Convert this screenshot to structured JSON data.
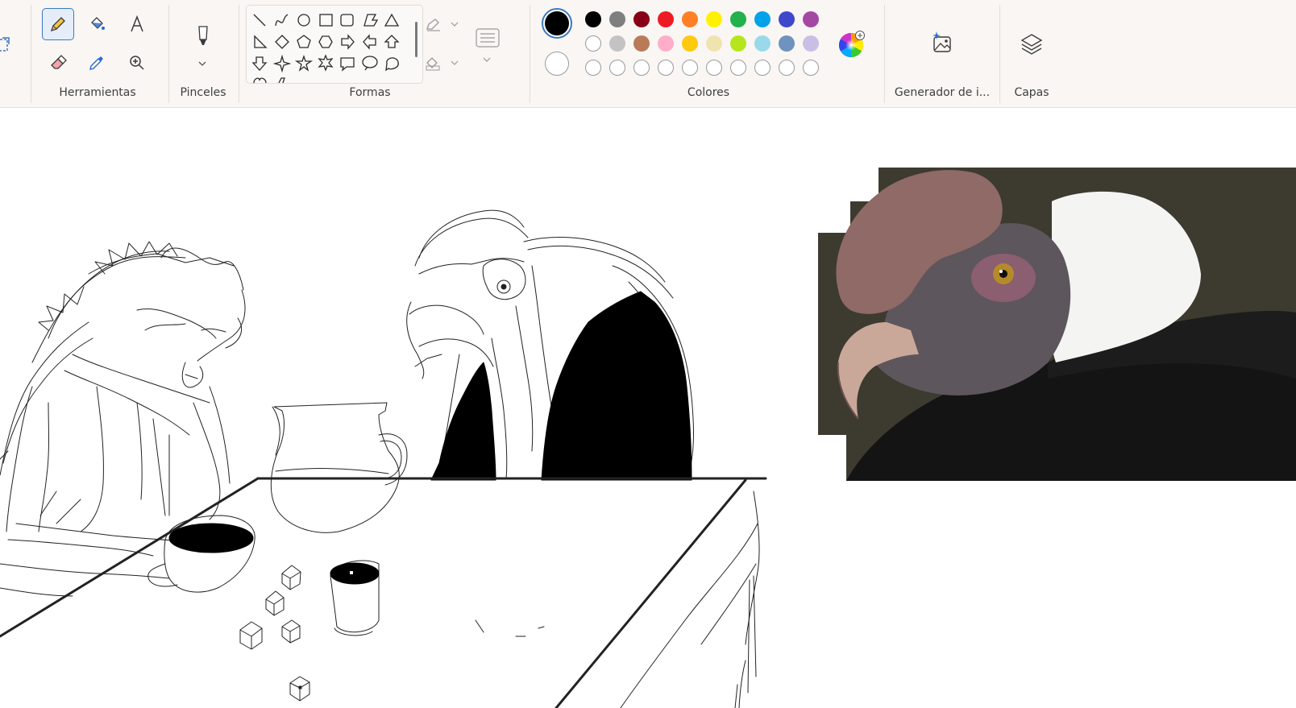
{
  "ribbon": {
    "groups": {
      "tools": "Herramientas",
      "brushes": "Pinceles",
      "shapes": "Formas",
      "colors": "Colores",
      "image_generator": "Generador de i...",
      "layers": "Capas"
    },
    "tools": [
      "pencil-icon",
      "fill-bucket-icon",
      "text-icon",
      "eraser-icon",
      "color-picker-icon",
      "magnifier-icon"
    ],
    "selected_tool": "pencil-icon",
    "shapes": [
      "line",
      "curve",
      "oval",
      "rectangle",
      "rounded-rectangle",
      "polygon",
      "triangle",
      "right-triangle",
      "diamond",
      "pentagon",
      "hexagon",
      "arrow-right",
      "arrow-left",
      "arrow-up",
      "arrow-down",
      "four-point-star",
      "five-point-star",
      "six-point-star",
      "rectangular-callout",
      "oval-callout",
      "cloud-callout",
      "heart",
      "lightning"
    ]
  },
  "colors": {
    "primary": "#000000",
    "secondary": "#ffffff",
    "palette_row1": [
      "#000000",
      "#7f7f7f",
      "#880015",
      "#ed1c24",
      "#ff7f27",
      "#fff200",
      "#22b14c",
      "#00a2e8",
      "#3f48cc",
      "#a349a4"
    ],
    "palette_row2": [
      "#ffffff",
      "#c3c3c3",
      "#b97a57",
      "#ffaec9",
      "#ffc90e",
      "#efe4b0",
      "#b5e61d",
      "#99d9ea",
      "#7092be",
      "#c8bfe7"
    ],
    "custom_slots": 10
  }
}
